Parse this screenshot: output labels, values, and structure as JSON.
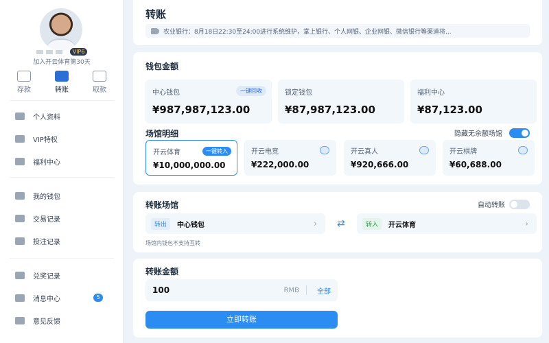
{
  "sidebar": {
    "vip": "VIP6",
    "join_text": "加入开云体育第30天",
    "quick": [
      {
        "label": "存款"
      },
      {
        "label": "转账"
      },
      {
        "label": "取款"
      }
    ],
    "nav": [
      {
        "label": "个人资料"
      },
      {
        "label": "VIP特权"
      },
      {
        "label": "福利中心"
      },
      {
        "label": "我的钱包"
      },
      {
        "label": "交易记录"
      },
      {
        "label": "投注记录"
      },
      {
        "label": "兑奖记录"
      },
      {
        "label": "消息中心",
        "badge": "5"
      },
      {
        "label": "意见反馈"
      }
    ]
  },
  "header": {
    "title": "转账",
    "notice": "农业银行：8月18日22:30至24:00进行系统维护，掌上银行、个人网银、企业网银、微信银行等渠道将..."
  },
  "wallet": {
    "title": "钱包金额",
    "items": [
      {
        "label": "中心钱包",
        "value": "¥987,987,123.00",
        "action": "一键回收"
      },
      {
        "label": "锁定钱包",
        "value": "¥87,987,123.00"
      },
      {
        "label": "福利中心",
        "value": "¥87,123.00"
      }
    ],
    "venue_title": "场馆明细",
    "hide_empty_label": "隐藏无余额场馆",
    "hide_empty_on": true,
    "venues": [
      {
        "label": "开云体育",
        "value": "¥10,000,000.00",
        "action": "一键转入"
      },
      {
        "label": "开云电竞",
        "value": "¥222,000.00"
      },
      {
        "label": "开云真人",
        "value": "¥920,666.00"
      },
      {
        "label": "开云棋牌",
        "value": "¥60,688.00"
      }
    ]
  },
  "transfer": {
    "title": "转账场馆",
    "auto_label": "自动转账",
    "auto_on": false,
    "out_tag": "转出",
    "out_value": "中心钱包",
    "in_tag": "转入",
    "in_value": "开云体育",
    "hint": "场馆内钱包不支持互转"
  },
  "amount": {
    "title": "转账金额",
    "value": "100",
    "unit": "RMB",
    "all_label": "全部",
    "submit_label": "立即转账"
  },
  "colors": {
    "accent": "#2b8df2",
    "background": "#eef3f9"
  }
}
